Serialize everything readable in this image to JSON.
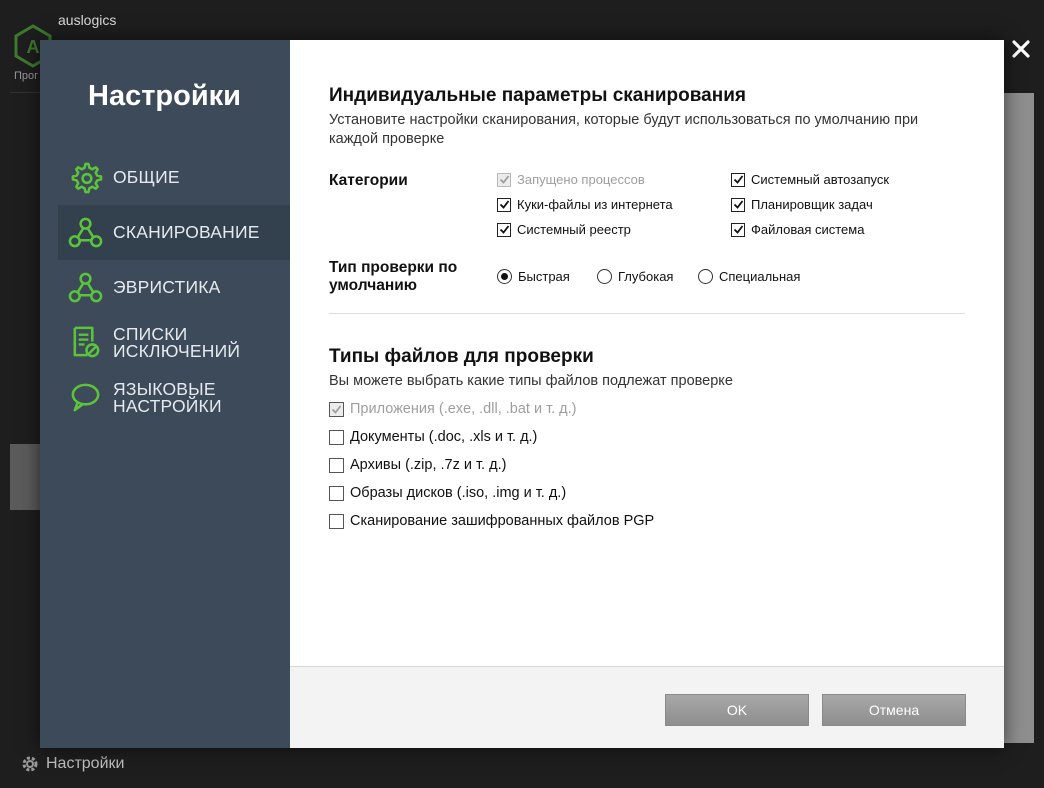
{
  "background": {
    "brand": "auslogics",
    "program_label": "Прог",
    "settings_label": "Настройки"
  },
  "sidebar": {
    "title": "Настройки",
    "items": [
      {
        "label": "ОБЩИЕ",
        "icon": "gear-icon",
        "active": false
      },
      {
        "label": "СКАНИРОВАНИЕ",
        "icon": "nodes-icon",
        "active": true
      },
      {
        "label": "ЭВРИСТИКА",
        "icon": "nodes-icon",
        "active": false
      },
      {
        "label": "СПИСКИ\nИСКЛЮЧЕНИЙ",
        "icon": "exclusion-list-icon",
        "active": false
      },
      {
        "label": "ЯЗЫКОВЫЕ\nНАСТРОЙКИ",
        "icon": "speech-bubble-icon",
        "active": false
      }
    ]
  },
  "scan_params": {
    "title": "Индивидуальные параметры сканирования",
    "description": "Установите настройки сканирования, которые будут использоваться по умолчанию при каждой проверке",
    "categories_label": "Категории",
    "categories": [
      {
        "label": "Запущено процессов",
        "checked": true,
        "disabled": true
      },
      {
        "label": "Системный автозапуск",
        "checked": true,
        "disabled": false
      },
      {
        "label": "Куки-файлы из интернета",
        "checked": true,
        "disabled": false
      },
      {
        "label": "Планировщик задач",
        "checked": true,
        "disabled": false
      },
      {
        "label": "Системный реестр",
        "checked": true,
        "disabled": false
      },
      {
        "label": "Файловая система",
        "checked": true,
        "disabled": false
      }
    ],
    "scan_type_label": "Тип проверки по\nумолчанию",
    "scan_types": [
      {
        "label": "Быстрая",
        "selected": true
      },
      {
        "label": "Глубокая",
        "selected": false
      },
      {
        "label": "Специальная",
        "selected": false
      }
    ]
  },
  "file_types": {
    "title": "Типы файлов для проверки",
    "description": "Вы можете выбрать какие типы файлов подлежат проверке",
    "options": [
      {
        "label": "Приложения (.exe, .dll, .bat и т. д.)",
        "checked": true,
        "disabled": true
      },
      {
        "label": "Документы (.doc, .xls и т. д.)",
        "checked": false,
        "disabled": false
      },
      {
        "label": "Архивы (.zip, .7z и т. д.)",
        "checked": false,
        "disabled": false
      },
      {
        "label": "Образы дисков (.iso, .img и т. д.)",
        "checked": false,
        "disabled": false
      },
      {
        "label": "Сканирование зашифрованных файлов PGP",
        "checked": false,
        "disabled": false
      }
    ]
  },
  "footer": {
    "ok_label": "OK",
    "cancel_label": "Отмена"
  },
  "colors": {
    "sidebar_bg": "#3c4a5a",
    "sidebar_active": "#33404e",
    "accent_green": "#5cc43a",
    "button_gray": "#9a9a9a"
  }
}
